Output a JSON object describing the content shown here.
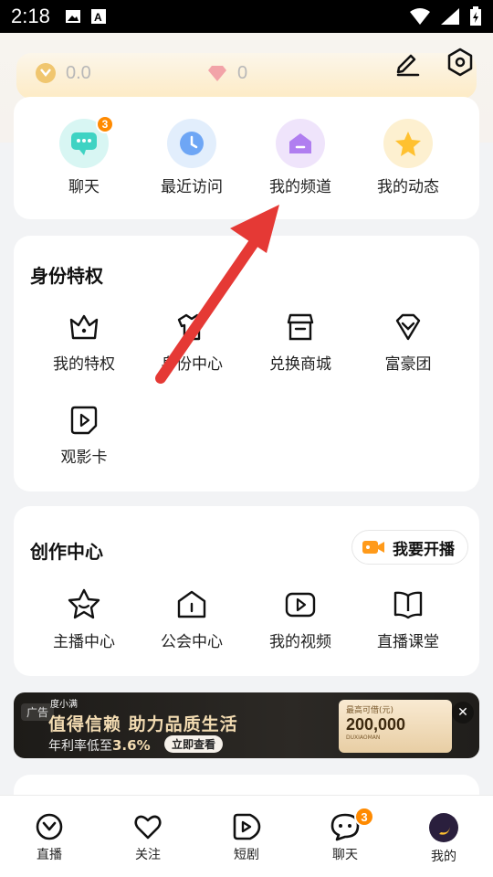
{
  "status_bar": {
    "time": "2:18"
  },
  "wallet": {
    "coins": "0.0",
    "diamonds": "0"
  },
  "quick_actions": [
    {
      "label": "聊天",
      "badge": "3"
    },
    {
      "label": "最近访问"
    },
    {
      "label": "我的频道"
    },
    {
      "label": "我的动态"
    }
  ],
  "identity": {
    "title": "身份特权",
    "items": [
      {
        "label": "我的特权"
      },
      {
        "label": "身份中心"
      },
      {
        "label": "兑换商城"
      },
      {
        "label": "富豪团"
      },
      {
        "label": "观影卡"
      }
    ]
  },
  "creation": {
    "title": "创作中心",
    "start_live": "我要开播",
    "items": [
      {
        "label": "主播中心"
      },
      {
        "label": "公会中心"
      },
      {
        "label": "我的视频"
      },
      {
        "label": "直播课堂"
      }
    ]
  },
  "ad": {
    "tag": "广告",
    "brand": "度小满",
    "title": "值得信赖  助力品质生活",
    "sub_prefix": "年利率低至",
    "rate": "3.6%",
    "cta": "立即查看",
    "card_caption": "最高可借(元)",
    "amount": "200,000",
    "card_en": "DUXIAOMAN"
  },
  "bottom_nav": [
    {
      "label": "直播"
    },
    {
      "label": "关注"
    },
    {
      "label": "短剧"
    },
    {
      "label": "聊天",
      "badge": "3"
    },
    {
      "label": "我的"
    }
  ],
  "colors": {
    "accent": "#ff8a00",
    "arrow": "#e53935"
  }
}
